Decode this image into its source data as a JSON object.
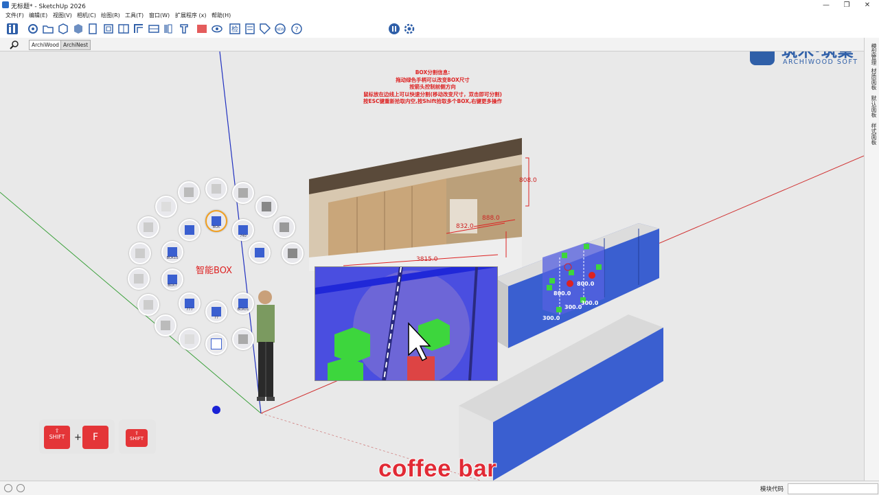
{
  "window": {
    "title": "无标题* - SketchUp 2026",
    "minimize": "—",
    "maximize": "❐",
    "close": "✕"
  },
  "menu": [
    "文件(F)",
    "编辑(E)",
    "视图(V)",
    "相机(C)",
    "绘图(R)",
    "工具(T)",
    "窗口(W)",
    "扩展程序 (x)",
    "帮助(H)"
  ],
  "tabs": [
    "ArchiWood",
    "ArchiNest"
  ],
  "right_panel": [
    "模型管理",
    "材质面板",
    "默认面板",
    "样式面板"
  ],
  "brand": {
    "zh": "筑木·筑巢",
    "en": "ARCHIWOOD SOFT"
  },
  "hint": {
    "lines": [
      "BOX分割信息:",
      "拖动绿色手柄可以改变BOX尺寸",
      "按箭头控制前侧方向",
      "鼠标放在边线上可以快速分割(移动改变尺寸，双击即可分割)",
      "按ESC键重新拾取内空,按Shift拾取多个BOX,右键更多操作"
    ]
  },
  "dimensions": {
    "d1": "808.0",
    "d2": "832.0",
    "d3": "888.0",
    "d4": "3815.0",
    "b1": "800.0",
    "b2": "800.0",
    "b3": "300.0",
    "b4": "300.0",
    "b5": "300.0"
  },
  "smart_box": {
    "label": "智能BOX",
    "items": [
      {
        "caption": ""
      },
      {
        "caption": ""
      },
      {
        "caption": ""
      },
      {
        "caption": ""
      },
      {
        "caption": "BOX"
      },
      {
        "caption": "740"
      },
      {
        "caption": ""
      },
      {
        "caption": ""
      },
      {
        "caption": ""
      },
      {
        "caption": "BOX10"
      },
      {
        "caption": ""
      },
      {
        "caption": ""
      },
      {
        "caption": ""
      },
      {
        "caption": "BOX7"
      },
      {
        "caption": ""
      },
      {
        "caption": ""
      },
      {
        "caption": "777"
      },
      {
        "caption": "BOX01"
      },
      {
        "caption": "77"
      },
      {
        "caption": ""
      },
      {
        "caption": ""
      },
      {
        "caption": ""
      },
      {
        "caption": ""
      },
      {
        "caption": ""
      }
    ]
  },
  "keys": {
    "shift": "SHIFT",
    "plus": "+",
    "f": "F",
    "shift2": "SHIFT"
  },
  "subtitle": "coffee bar",
  "status": {
    "label": "模块代码",
    "value": ""
  }
}
